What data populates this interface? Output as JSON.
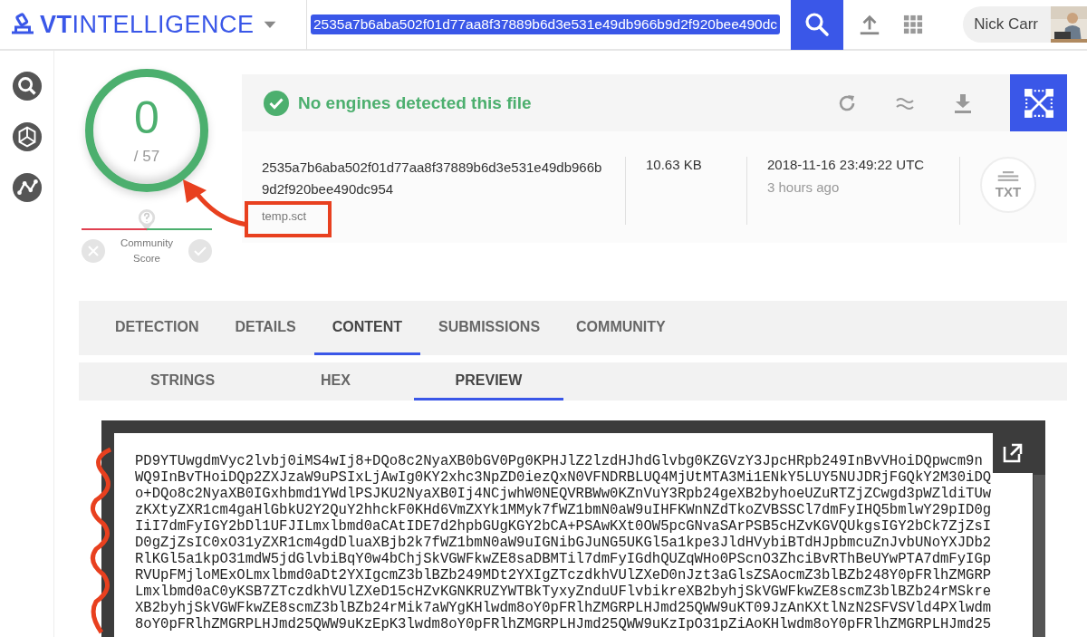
{
  "header": {
    "logo_prefix": "VT",
    "logo_suffix": "INTELLIGENCE",
    "search_value": "2535a7b6aba502f01d77aa8f37889b6d3e531e49db966b9d2f920bee490dc",
    "user_name": "Nick Carr"
  },
  "score": {
    "detections": "0",
    "total": "/ 57",
    "community_label": "Community Score"
  },
  "banner": {
    "message": "No engines detected this file"
  },
  "file": {
    "hash": "2535a7b6aba502f01d77aa8f37889b6d3e531e49db966b9d2f920bee490dc954",
    "name": "temp.sct",
    "size": "10.63 KB",
    "date": "2018-11-16 23:49:22 UTC",
    "relative": "3 hours ago",
    "type_label": "TXT"
  },
  "tabs": [
    {
      "label": "DETECTION",
      "selected": false
    },
    {
      "label": "DETAILS",
      "selected": false
    },
    {
      "label": "CONTENT",
      "selected": true
    },
    {
      "label": "SUBMISSIONS",
      "selected": false
    },
    {
      "label": "COMMUNITY",
      "selected": false
    }
  ],
  "subtabs": [
    {
      "label": "STRINGS",
      "selected": false
    },
    {
      "label": "HEX",
      "selected": false
    },
    {
      "label": "PREVIEW",
      "selected": true
    }
  ],
  "preview_lines": [
    "PD9YTUwgdmVyc2lvbj0iMS4wIj8+DQo8c2NyaXB0bGV0Pg0KPHJlZ2lzdHJhdGlvbg0KZGVzY3JpcHRpb249InBvVHoiDQpwcm9n",
    "WQ9InBvTHoiDQp2ZXJzaW9uPSIxLjAwIg0KY2xhc3NpZD0iezQxN0VFNDRBLUQ4MjUtMTA3Mi1ENkY5LUY5NUJDRjFGQkY2M30iDQ",
    "o+DQo8c2NyaXB0IGxhbmd1YWdlPSJKU2NyaXB0Ij4NCjwhW0NEQVRBWw0KZnVuY3Rpb24geXB2byhoeUZuRTZjZCwgd3pWZldiTUw",
    "zKXtyZXR1cm4gaHlGbkU2Y2QuY2hhckF0KHd6VmZXYk1MMyk7fWZ1bmN0aW9uIHFKWnNZdTkoZVBSSCl7dmFyIHQ5bmlwY29pID0g",
    "IiI7dmFyIGY2bDl1UFJILmxlbmd0aCAtIDE7d2hpbGUgKGY2bCA+PSAwKXt0OW5pcGNvaSArPSB5cHZvKGVQUkgsIGY2bCk7ZjZsI",
    "D0gZjZsIC0xO31yZXR1cm4gdDluaXBjb2k7fWZ1bmN0aW9uIGNibGJuNG5UKGl5a1kpe3JldHVybiBTdHJpbmcuZnJvbUNoYXJDb2",
    "RlKGl5a1kpO31mdW5jdGlvbiBqY0w4bChjSkVGWFkwZE8saDBMTil7dmFyIGdhQUZqWHo0PScnO3ZhciBvRThBeUYwPTA7dmFyIGp",
    "RVUpFMjloMExOLmxlbmd0aDt2YXIgcmZ3blBZb249MDt2YXIgZTczdkhVUlZXeD0nJzt3aGlsZSAocmZ3blBZb248Y0pFRlhZMGRP",
    "Lmxlbmd0aC0yKSB7ZTczdkhVUlZXeD15cHZvKGNKRUZYWTBkTyxyZnduUFlvbikreXB2byhjSkVGWFkwZE8scmZ3blBZb24rMSkre",
    "XB2byhjSkVGWFkwZE8scmZ3blBZb24rMik7aWYgKHlwdm8oY0pFRlhZMGRPLHJmd25QWW9uKT09JzAnKXtlNzN2SFVSVld4PXlwdm",
    "8oY0pFRlhZMGRPLHJmd25QWW9uKzEpK3lwdm8oY0pFRlhZMGRPLHJmd25QWW9uKzIpO31pZiAoKHlwdm8oY0pFRlhZMGRPLHJmd25"
  ]
}
